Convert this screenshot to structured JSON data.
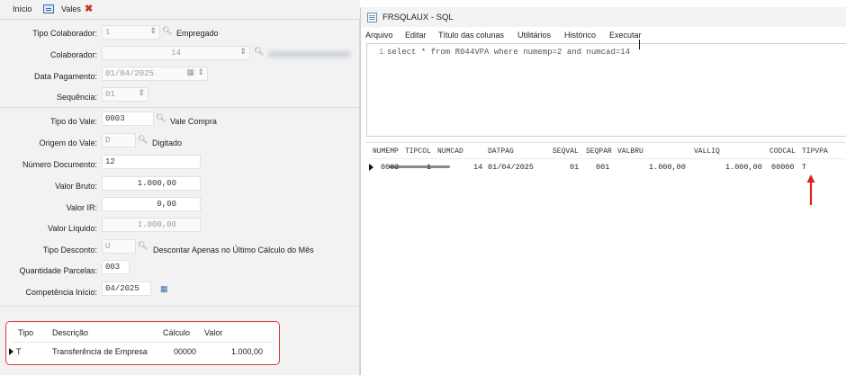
{
  "tabs": {
    "home": "Início",
    "vales": "Vales"
  },
  "form": {
    "tipo_colaborador": {
      "label": "Tipo Colaborador:",
      "value": "1",
      "desc": "Empregado"
    },
    "colaborador": {
      "label": "Colaborador:",
      "value": "14"
    },
    "data_pagamento": {
      "label": "Data Pagamento:",
      "value": "01/04/2025"
    },
    "sequencia": {
      "label": "Sequência:",
      "value": "01"
    },
    "tipo_vale": {
      "label": "Tipo do Vale:",
      "value": "0003",
      "desc": "Vale Compra"
    },
    "origem_vale": {
      "label": "Origem do Vale:",
      "value": "D",
      "desc": "Digitado"
    },
    "numero_documento": {
      "label": "Número Documento:",
      "value": "12"
    },
    "valor_bruto": {
      "label": "Valor Bruto:",
      "value": "1.000,00"
    },
    "valor_ir": {
      "label": "Valor IR:",
      "value": "0,00"
    },
    "valor_liquido": {
      "label": "Valor Líquido:",
      "value": "1.000,00"
    },
    "tipo_desconto": {
      "label": "Tipo Desconto:",
      "value": "U",
      "desc": "Descontar Apenas no Último Cálculo do Mês"
    },
    "quantidade_parcelas": {
      "label": "Quantidade Parcelas:",
      "value": "003"
    },
    "competencia_inicio": {
      "label": "Competência Início:",
      "value": "04/2025"
    }
  },
  "grid": {
    "headers": [
      "Tipo",
      "Descrição",
      "Cálculo",
      "Valor"
    ],
    "row": [
      "T",
      "Transferência de Empresa",
      "00000",
      "1.000,00"
    ]
  },
  "sql_window": {
    "title": "FRSQLAUX - SQL",
    "menu": [
      "Arquivo",
      "Editar",
      "Título das colunas",
      "Utilitários",
      "Histórico",
      "Executar"
    ],
    "line_number": "1",
    "query": "select * from R044VPA where numemp=2 and numcad=14",
    "columns": [
      "NUMEMP",
      "TIPCOL",
      "NUMCAD",
      "DATPAG",
      "SEQVAL",
      "SEQPAR",
      "VALBRU",
      "VALLIQ",
      "CODCAL",
      "TIPVPA"
    ],
    "row": [
      "0002",
      "1",
      "14",
      "01/04/2025",
      "01",
      "001",
      "1.000,00",
      "1.000,00",
      "00000",
      "T"
    ]
  },
  "colors": {
    "highlight": "#e0393b",
    "arrow": "#e02020"
  },
  "icons": [
    "search-icon",
    "calendar-icon",
    "spinner-icon",
    "close-icon",
    "grid-icon"
  ]
}
